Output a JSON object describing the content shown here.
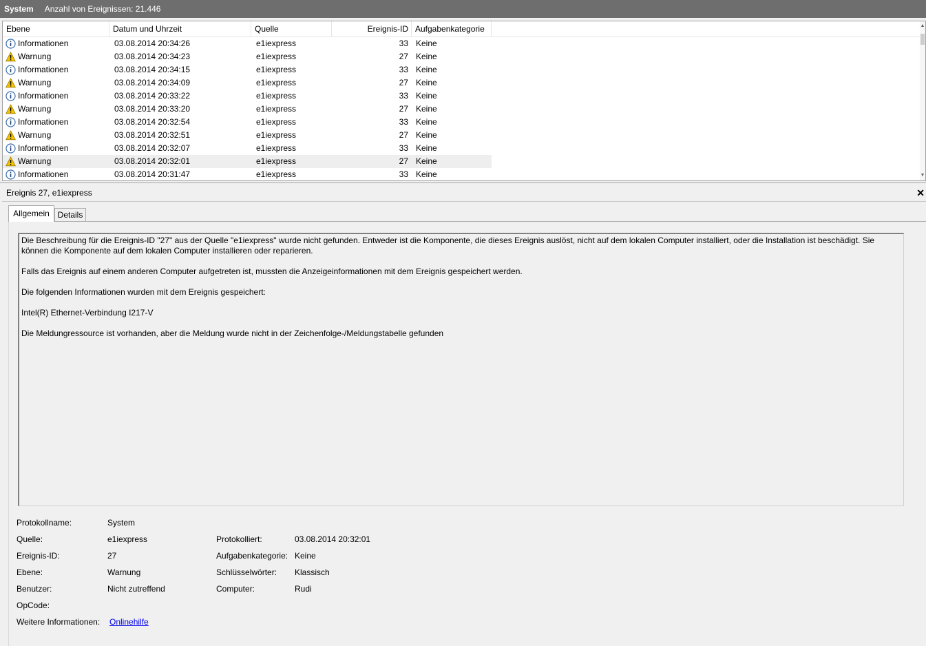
{
  "titlebar": {
    "log_name": "System",
    "event_count": "Anzahl von Ereignissen: 21.446"
  },
  "list": {
    "columns": [
      "Ebene",
      "Datum und Uhrzeit",
      "Quelle",
      "Ereignis-ID",
      "Aufgabenkategorie"
    ],
    "rows": [
      {
        "level": "Informationen",
        "icon": "info-icon",
        "date": "03.08.2014 20:34:26",
        "source": "e1iexpress",
        "id": "33",
        "category": "Keine"
      },
      {
        "level": "Warnung",
        "icon": "warning-icon",
        "date": "03.08.2014 20:34:23",
        "source": "e1iexpress",
        "id": "27",
        "category": "Keine"
      },
      {
        "level": "Informationen",
        "icon": "info-icon",
        "date": "03.08.2014 20:34:15",
        "source": "e1iexpress",
        "id": "33",
        "category": "Keine"
      },
      {
        "level": "Warnung",
        "icon": "warning-icon",
        "date": "03.08.2014 20:34:09",
        "source": "e1iexpress",
        "id": "27",
        "category": "Keine"
      },
      {
        "level": "Informationen",
        "icon": "info-icon",
        "date": "03.08.2014 20:33:22",
        "source": "e1iexpress",
        "id": "33",
        "category": "Keine"
      },
      {
        "level": "Warnung",
        "icon": "warning-icon",
        "date": "03.08.2014 20:33:20",
        "source": "e1iexpress",
        "id": "27",
        "category": "Keine"
      },
      {
        "level": "Informationen",
        "icon": "info-icon",
        "date": "03.08.2014 20:32:54",
        "source": "e1iexpress",
        "id": "33",
        "category": "Keine"
      },
      {
        "level": "Warnung",
        "icon": "warning-icon",
        "date": "03.08.2014 20:32:51",
        "source": "e1iexpress",
        "id": "27",
        "category": "Keine"
      },
      {
        "level": "Informationen",
        "icon": "info-icon",
        "date": "03.08.2014 20:32:07",
        "source": "e1iexpress",
        "id": "33",
        "category": "Keine"
      },
      {
        "level": "Warnung",
        "icon": "warning-icon",
        "date": "03.08.2014 20:32:01",
        "source": "e1iexpress",
        "id": "27",
        "category": "Keine",
        "selected": true
      },
      {
        "level": "Informationen",
        "icon": "info-icon",
        "date": "03.08.2014 20:31:47",
        "source": "e1iexpress",
        "id": "33",
        "category": "Keine"
      }
    ]
  },
  "detail": {
    "title": "Ereignis 27, e1iexpress",
    "close_glyph": "✕",
    "tabs": [
      "Allgemein",
      "Details"
    ],
    "description": [
      "Die Beschreibung für die Ereignis-ID \"27\" aus der Quelle \"e1iexpress\" wurde nicht gefunden. Entweder ist die Komponente, die dieses Ereignis auslöst, nicht auf dem lokalen Computer installiert, oder die Installation ist beschädigt. Sie können die Komponente auf dem lokalen Computer installieren oder reparieren.",
      "Falls das Ereignis auf einem anderen Computer aufgetreten ist, mussten die Anzeigeinformationen mit dem Ereignis gespeichert werden.",
      "Die folgenden Informationen wurden mit dem Ereignis gespeichert:",
      "Intel(R) Ethernet-Verbindung I217-V",
      "Die Meldungressource ist vorhanden, aber die Meldung wurde nicht in der Zeichenfolge-/Meldungstabelle gefunden"
    ],
    "props": {
      "log_label": "Protokollname:",
      "log_value": "System",
      "source_label": "Quelle:",
      "source_value": "e1iexpress",
      "logged_label": "Protokolliert:",
      "logged_value": "03.08.2014 20:32:01",
      "id_label": "Ereignis-ID:",
      "id_value": "27",
      "task_label": "Aufgabenkategorie:",
      "task_value": "Keine",
      "level_label": "Ebene:",
      "level_value": "Warnung",
      "keywords_label": "Schlüsselwörter:",
      "keywords_value": "Klassisch",
      "user_label": "Benutzer:",
      "user_value": "Nicht zutreffend",
      "computer_label": "Computer:",
      "computer_value": "Rudi",
      "opcode_label": "OpCode:",
      "more_label": "Weitere Informationen:",
      "more_link": "Onlinehilfe"
    }
  },
  "colors": {
    "titlebar_bg": "#6e6e6e",
    "selected_row": "#eeeeee",
    "link": "#0000ee",
    "warning": "#f5c400",
    "info": "#3a6fb0"
  }
}
